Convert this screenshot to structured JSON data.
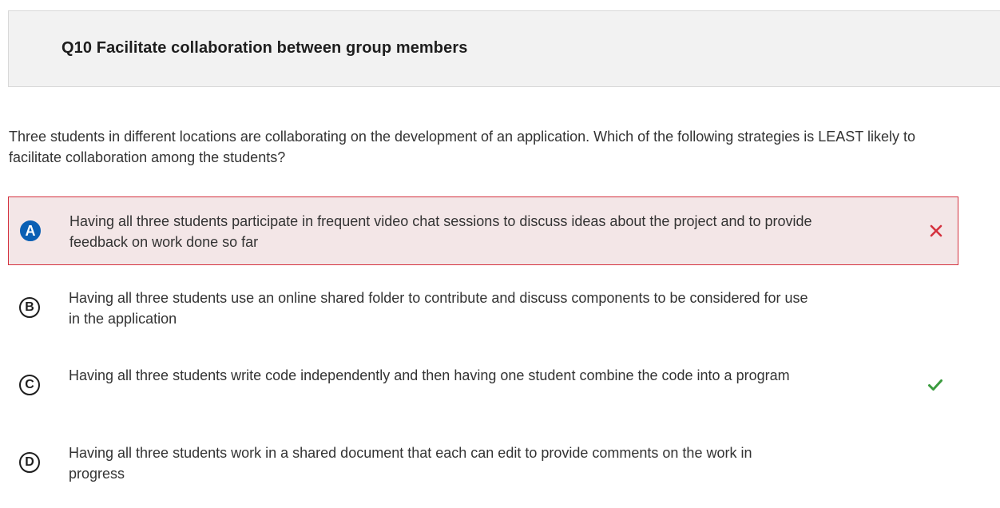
{
  "question": {
    "title": "Q10 Facilitate collaboration between group members",
    "stem": "Three students in different locations are collaborating on the development of an application. Which of the following strategies is LEAST likely to facilitate collaboration among the students?"
  },
  "options": [
    {
      "letter": "A",
      "text": "Having all three students participate in frequent video chat sessions to discuss ideas about the project and to provide feedback on work done so far",
      "state": "selected-incorrect",
      "mark": "x-icon"
    },
    {
      "letter": "B",
      "text": "Having all three students use an online shared folder to contribute and discuss components to be considered for use in the application",
      "state": "none"
    },
    {
      "letter": "C",
      "text": "Having all three students write code independently and then having one student combine the code into a program",
      "state": "correct",
      "mark": "check-icon"
    },
    {
      "letter": "D",
      "text": "Having all three students work in a shared document that each can edit to provide comments on the work in progress",
      "state": "none"
    }
  ],
  "colors": {
    "incorrect": "#d4313e",
    "incorrect_bg": "#f3e6e7",
    "correct": "#3a9b3e",
    "selected_letter": "#0a5fb4",
    "header_bg": "#f2f2f2"
  }
}
